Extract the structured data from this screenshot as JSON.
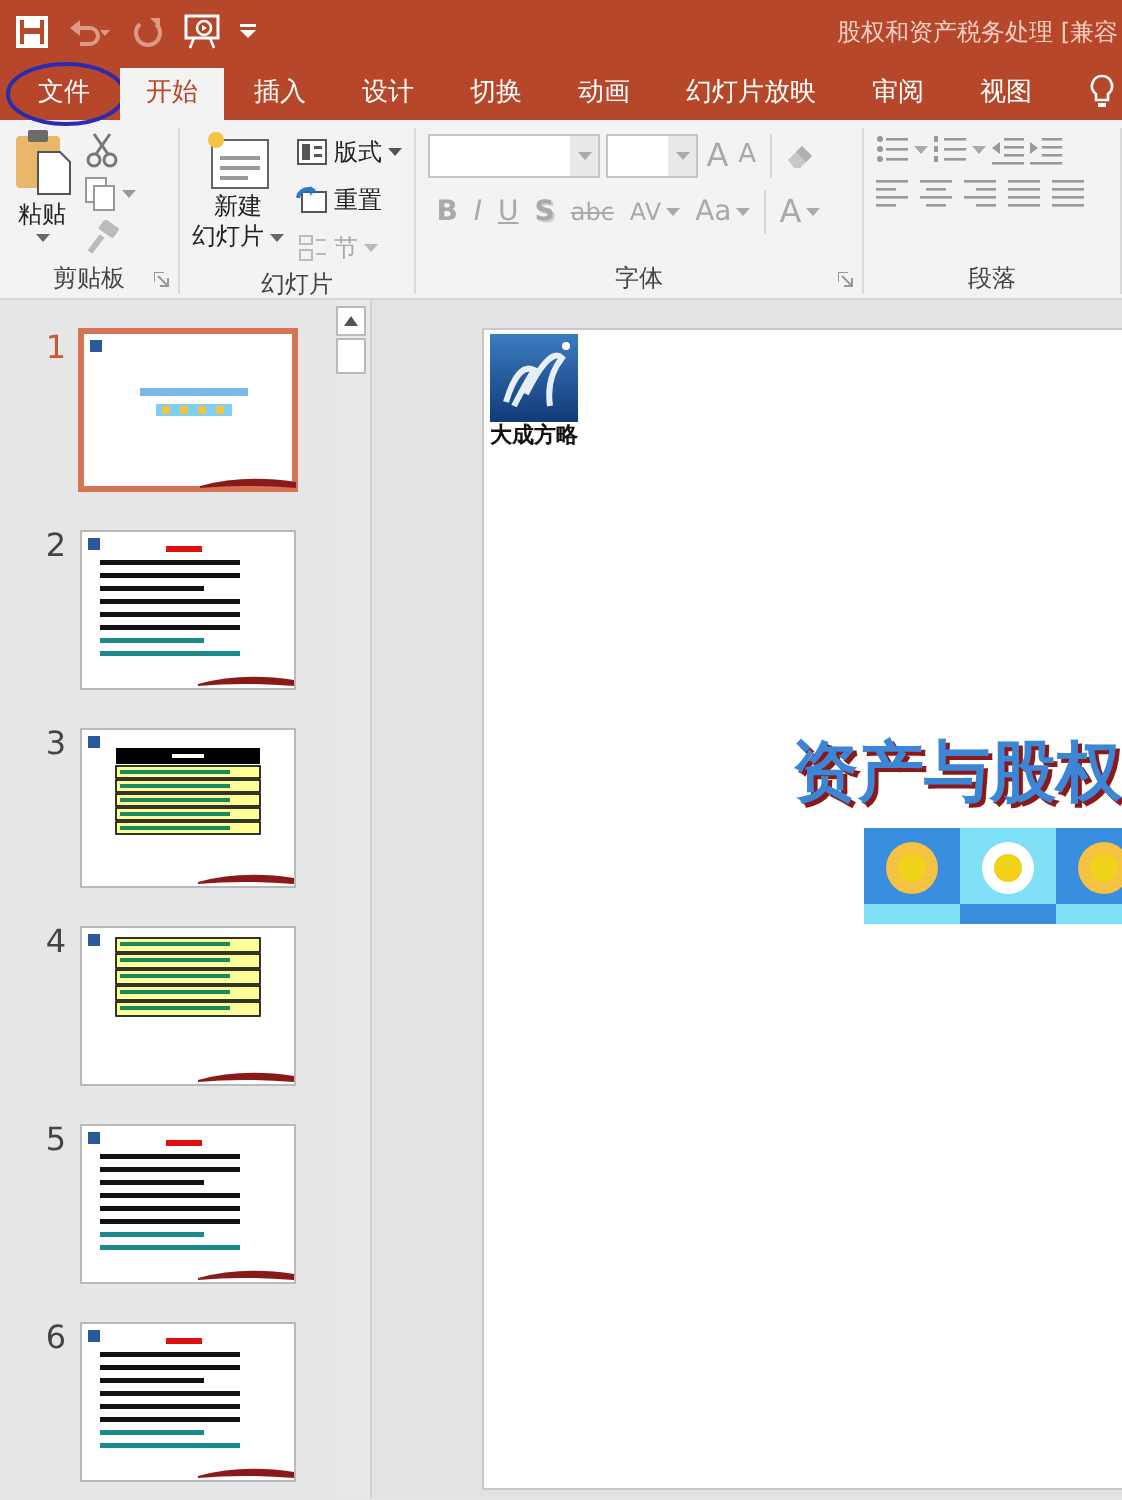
{
  "window": {
    "title": "股权和资产税务处理 [兼容"
  },
  "quick_access": [
    {
      "kind": "save",
      "disabled": false
    },
    {
      "kind": "undo",
      "disabled": true
    },
    {
      "kind": "redo",
      "disabled": true
    },
    {
      "kind": "present",
      "disabled": false
    },
    {
      "kind": "customize",
      "disabled": false
    }
  ],
  "tabs": [
    {
      "label": "文件",
      "selected": false,
      "circled": true
    },
    {
      "label": "开始",
      "selected": true,
      "circled": false
    },
    {
      "label": "插入",
      "selected": false,
      "circled": false
    },
    {
      "label": "设计",
      "selected": false,
      "circled": false
    },
    {
      "label": "切换",
      "selected": false,
      "circled": false
    },
    {
      "label": "动画",
      "selected": false,
      "circled": false
    },
    {
      "label": "幻灯片放映",
      "selected": false,
      "circled": false
    },
    {
      "label": "审阅",
      "selected": false,
      "circled": false
    },
    {
      "label": "视图",
      "selected": false,
      "circled": false
    }
  ],
  "ribbon": {
    "groups": [
      {
        "kind": "clipboard",
        "label": "剪贴板",
        "launcher": true,
        "paste": "粘贴"
      },
      {
        "kind": "slides",
        "label": "幻灯片",
        "launcher": false,
        "new_slide": "新建",
        "new_slide_line2": "幻灯片",
        "buttons": [
          {
            "label": "版式",
            "kind": "layout",
            "dropdown": true,
            "disabled": false
          },
          {
            "label": "重置",
            "kind": "reset",
            "dropdown": false,
            "disabled": false
          },
          {
            "label": "节",
            "kind": "section",
            "dropdown": true,
            "disabled": true
          }
        ]
      },
      {
        "kind": "font",
        "label": "字体",
        "launcher": true,
        "size_buttons": [
          {
            "label": "A",
            "kind": "grow",
            "disabled": true
          },
          {
            "label": "A",
            "kind": "shrink",
            "disabled": true
          }
        ],
        "format_buttons": [
          {
            "label": "B",
            "kind": "bold",
            "dropdown": false,
            "disabled": true
          },
          {
            "label": "I",
            "kind": "italic",
            "dropdown": false,
            "disabled": true
          },
          {
            "label": "U",
            "kind": "underline",
            "dropdown": false,
            "disabled": true
          },
          {
            "label": "S",
            "kind": "shadow",
            "dropdown": false,
            "disabled": true
          },
          {
            "label": "abc",
            "kind": "strike",
            "dropdown": false,
            "disabled": true
          },
          {
            "label": "AV",
            "kind": "spacing",
            "dropdown": true,
            "disabled": true
          },
          {
            "label": "Aa",
            "kind": "case",
            "dropdown": true,
            "disabled": true
          },
          {
            "label": "A",
            "kind": "color",
            "dropdown": true,
            "disabled": true
          }
        ]
      },
      {
        "kind": "paragraph",
        "label": "段落",
        "launcher": false
      }
    ]
  },
  "thumbnails": [
    {
      "number": "1",
      "selected": true,
      "kind": "title"
    },
    {
      "number": "2",
      "selected": false,
      "kind": "bullets"
    },
    {
      "number": "3",
      "selected": false,
      "kind": "table"
    },
    {
      "number": "4",
      "selected": false,
      "kind": "boxes"
    },
    {
      "number": "5",
      "selected": false,
      "kind": "bullets"
    },
    {
      "number": "6",
      "selected": false,
      "kind": "bullets"
    }
  ],
  "slide": {
    "logo_text": "大成方略",
    "title": "资产与股权"
  }
}
